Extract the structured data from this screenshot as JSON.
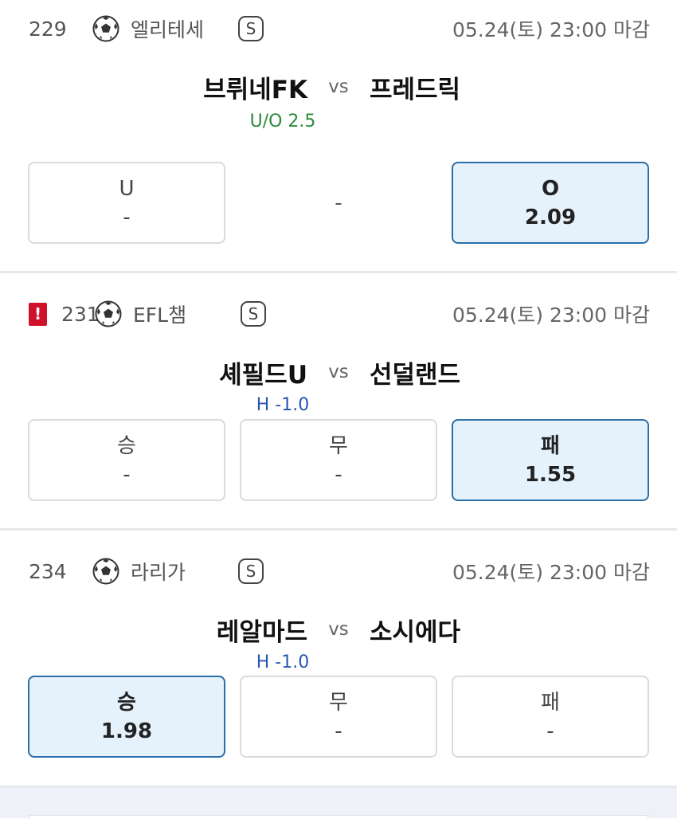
{
  "matches": [
    {
      "number": "229",
      "league": "엘리테세",
      "special_badge": "S",
      "deadline": "05.24(토) 23:00 마감",
      "home": "브뤼네FK",
      "vs": "vs",
      "away": "프레드릭",
      "handicap": "U/O 2.5",
      "middle": "-",
      "odds": [
        {
          "label": "U",
          "value": "-"
        },
        {
          "label": "O",
          "value": "2.09"
        }
      ]
    },
    {
      "warning": "!",
      "number": "231",
      "league": "EFL챔",
      "special_badge": "S",
      "deadline": "05.24(토) 23:00 마감",
      "home": "셰필드U",
      "vs": "vs",
      "away": "선덜랜드",
      "handicap": "H -1.0",
      "odds": [
        {
          "label": "승",
          "value": "-"
        },
        {
          "label": "무",
          "value": "-"
        },
        {
          "label": "패",
          "value": "1.55"
        }
      ]
    },
    {
      "number": "234",
      "league": "라리가",
      "special_badge": "S",
      "deadline": "05.24(토) 23:00 마감",
      "home": "레알마드",
      "vs": "vs",
      "away": "소시에다",
      "handicap": "H -1.0",
      "odds": [
        {
          "label": "승",
          "value": "1.98"
        },
        {
          "label": "무",
          "value": "-"
        },
        {
          "label": "패",
          "value": "-"
        }
      ]
    }
  ],
  "icons": {
    "league_icon": "soccer-ball-icon"
  },
  "colors": {
    "selected_bg": "#e6f2fb",
    "selected_border": "#2c6ea8",
    "warning": "#d0112b",
    "uo_text": "#2a8a3a",
    "handicap_text": "#2956b2"
  }
}
